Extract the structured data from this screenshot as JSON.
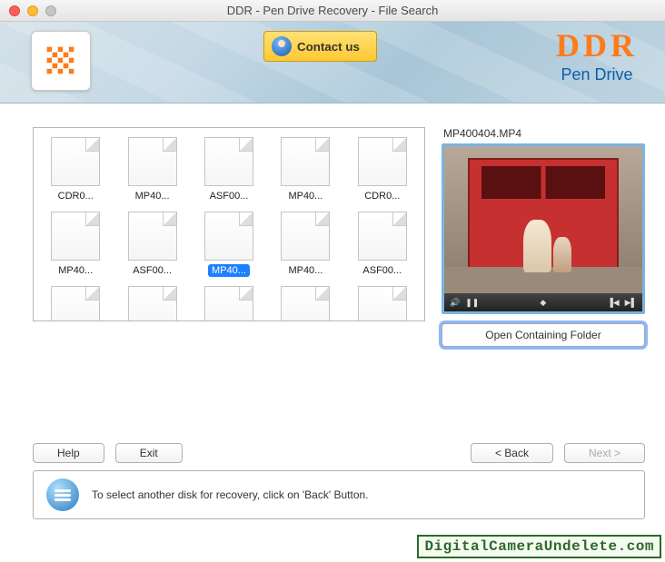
{
  "window": {
    "title": "DDR - Pen Drive Recovery - File Search"
  },
  "header": {
    "contact_label": "Contact us",
    "brand_main": "DDR",
    "brand_sub": "Pen Drive"
  },
  "files": [
    {
      "name": "CDR0..."
    },
    {
      "name": "MP40..."
    },
    {
      "name": "ASF00..."
    },
    {
      "name": "MP40..."
    },
    {
      "name": "CDR0..."
    },
    {
      "name": "MP40..."
    },
    {
      "name": "ASF00..."
    },
    {
      "name": "MP40...",
      "selected": true
    },
    {
      "name": "MP40..."
    },
    {
      "name": "ASF00..."
    },
    {
      "name": ""
    },
    {
      "name": ""
    },
    {
      "name": ""
    },
    {
      "name": ""
    },
    {
      "name": ""
    }
  ],
  "preview": {
    "title": "MP400404.MP4",
    "open_label": "Open Containing Folder"
  },
  "buttons": {
    "help": "Help",
    "exit": "Exit",
    "back": "< Back",
    "next": "Next >"
  },
  "info": {
    "text": "To select another disk for recovery, click on 'Back' Button."
  },
  "watermark": "DigitalCameraUndelete.com"
}
